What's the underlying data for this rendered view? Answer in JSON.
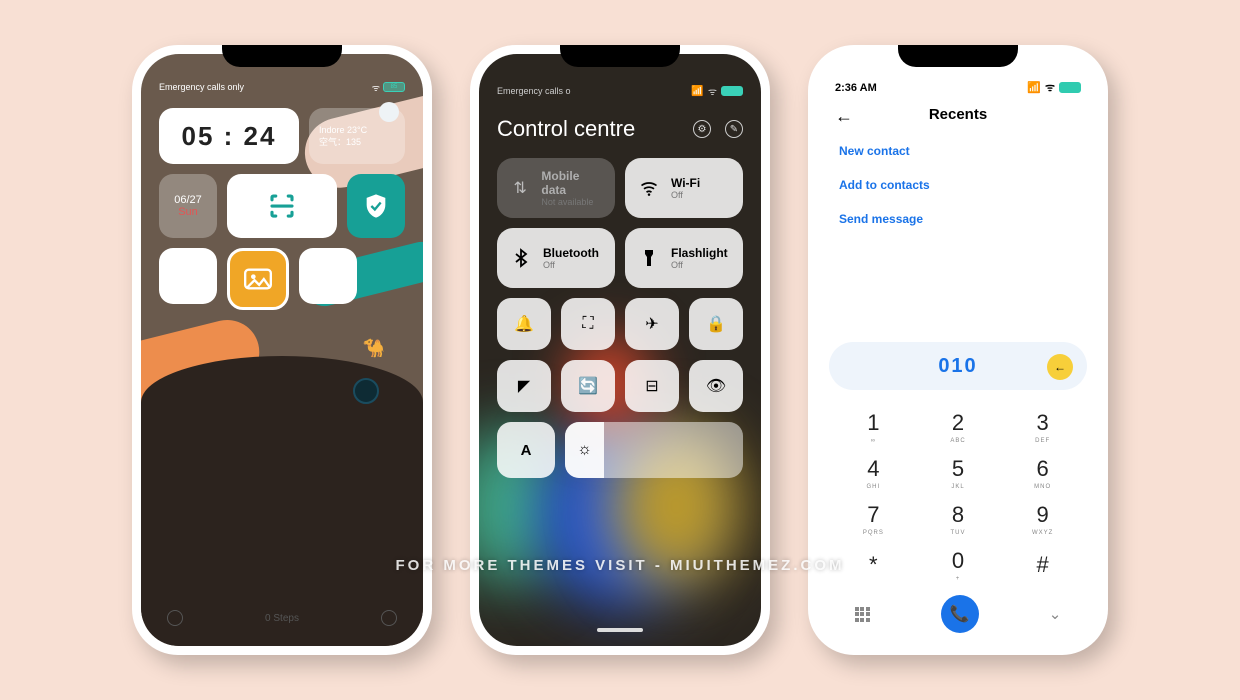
{
  "watermark": "FOR MORE THEMES VISIT - MIUITHEMEZ.COM",
  "phone1": {
    "status": {
      "network": "Emergency calls only",
      "battery": "85"
    },
    "clock": "05 : 24",
    "weather": {
      "city": "Indore",
      "temp": "23°C",
      "aqi": "空气：135"
    },
    "date": {
      "date": "06/27",
      "dow": "Sun"
    },
    "steps": "0 Steps"
  },
  "phone2": {
    "status": {
      "network": "Emergency calls o"
    },
    "title": "Control centre",
    "tiles": {
      "mobile": {
        "name": "Mobile data",
        "state": "Not available"
      },
      "wifi": {
        "name": "Wi-Fi",
        "state": "Off"
      },
      "bt": {
        "name": "Bluetooth",
        "state": "Off"
      },
      "flash": {
        "name": "Flashlight",
        "state": "Off"
      }
    },
    "sliderA": "A"
  },
  "phone3": {
    "status": {
      "time": "2:36 AM"
    },
    "title": "Recents",
    "links": {
      "newContact": "New contact",
      "addTo": "Add to contacts",
      "sendMsg": "Send message"
    },
    "number": "010",
    "keys": [
      {
        "d": "1",
        "l": "∞"
      },
      {
        "d": "2",
        "l": "ABC"
      },
      {
        "d": "3",
        "l": "DEF"
      },
      {
        "d": "4",
        "l": "GHI"
      },
      {
        "d": "5",
        "l": "JKL"
      },
      {
        "d": "6",
        "l": "MNO"
      },
      {
        "d": "7",
        "l": "PQRS"
      },
      {
        "d": "8",
        "l": "TUV"
      },
      {
        "d": "9",
        "l": "WXYZ"
      },
      {
        "d": "*",
        "l": ""
      },
      {
        "d": "0",
        "l": "+"
      },
      {
        "d": "#",
        "l": ""
      }
    ]
  }
}
